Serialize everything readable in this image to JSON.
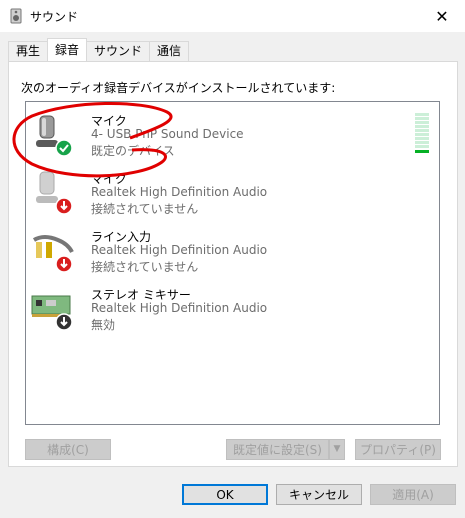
{
  "window": {
    "title": "サウンド",
    "close_icon": "close-icon"
  },
  "tabs": [
    {
      "label": "再生"
    },
    {
      "label": "録音"
    },
    {
      "label": "サウンド"
    },
    {
      "label": "通信"
    }
  ],
  "panel": {
    "description": "次のオーディオ録音デバイスがインストールされています:"
  },
  "devices": [
    {
      "name": "マイク",
      "detail": "4- USB PnP Sound Device",
      "status": "既定のデバイス",
      "badge": "check",
      "level": 0.08
    },
    {
      "name": "マイク",
      "detail": "Realtek High Definition Audio",
      "status": "接続されていません",
      "badge": "down"
    },
    {
      "name": "ライン入力",
      "detail": "Realtek High Definition Audio",
      "status": "接続されていません",
      "badge": "down"
    },
    {
      "name": "ステレオ ミキサー",
      "detail": "Realtek High Definition Audio",
      "status": "無効",
      "badge": "down-dark"
    }
  ],
  "buttons": {
    "configure": "構成(C)",
    "set_default": "既定値に設定(S)",
    "properties": "プロパティ(P)",
    "ok": "OK",
    "cancel": "キャンセル",
    "apply": "適用(A)"
  },
  "colors": {
    "accent": "#0078d7",
    "annotation": "#e00000",
    "check_green": "#17a34a",
    "down_red": "#d91e1e"
  }
}
